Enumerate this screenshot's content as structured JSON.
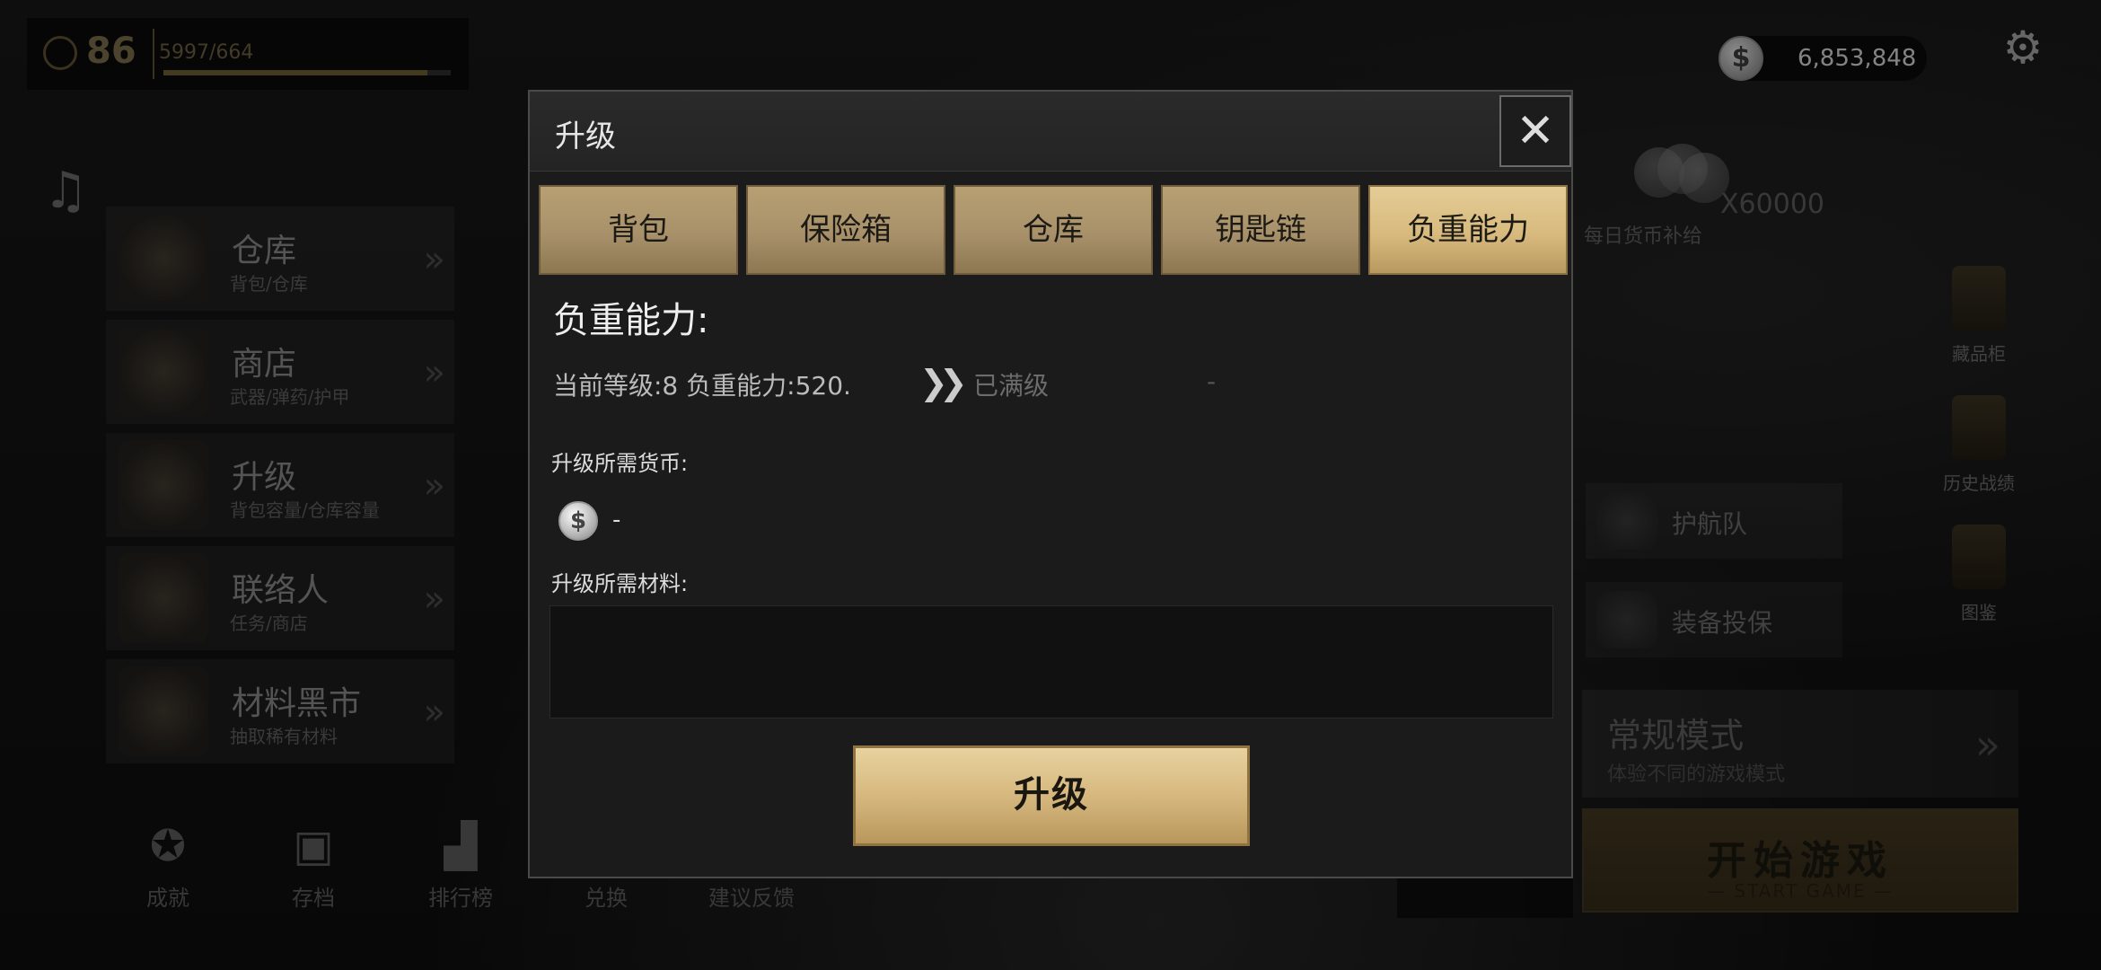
{
  "player": {
    "level": "86",
    "xp": "5997/664",
    "xp_progress": 0.92
  },
  "currency": {
    "icon": "dollar-coin-icon",
    "symbol": "$",
    "amount": "6,853,848"
  },
  "left_menu": [
    {
      "title": "仓库",
      "subtitle": "背包/仓库"
    },
    {
      "title": "商店",
      "subtitle": "武器/弹药/护甲"
    },
    {
      "title": "升级",
      "subtitle": "背包容量/仓库容量"
    },
    {
      "title": "联络人",
      "subtitle": "任务/商店"
    },
    {
      "title": "材料黑市",
      "subtitle": "抽取稀有材料"
    }
  ],
  "bottom_nav": [
    {
      "label": "成就",
      "icon": "achievement-icon"
    },
    {
      "label": "存档",
      "icon": "save-icon"
    },
    {
      "label": "排行榜",
      "icon": "leaderboard-icon"
    },
    {
      "label": "兑换",
      "icon": ""
    },
    {
      "label": "建议反馈",
      "icon": ""
    }
  ],
  "daily": {
    "quantity": "X60000",
    "label": "每日货币补给"
  },
  "right_side": [
    {
      "label": "藏品柜"
    },
    {
      "label": "历史战绩"
    },
    {
      "label": "图鉴"
    }
  ],
  "right_buttons": [
    {
      "label": "护航队"
    },
    {
      "label": "装备投保"
    }
  ],
  "mode": {
    "title": "常规模式",
    "subtitle": "体验不同的游戏模式"
  },
  "start": {
    "title": "开始游戏",
    "subtitle": "— START GAME —"
  },
  "modal": {
    "title": "升级",
    "close_symbol": "✕",
    "tabs": [
      "背包",
      "保险箱",
      "仓库",
      "钥匙链",
      "负重能力"
    ],
    "active_tab": 4,
    "section_title": "负重能力:",
    "info": {
      "current": "当前等级:8   负重能力:520.",
      "arrow": "❯❯",
      "maxed": "已满级",
      "dash": "-"
    },
    "currency_label": "升级所需货币:",
    "currency_cost": "-",
    "materials_label": "升级所需材料:",
    "upgrade_button": "升级"
  },
  "colors": {
    "gold": "#d8ba7e",
    "gold_dark": "#a8916a",
    "panel": "#1b1b1b"
  }
}
